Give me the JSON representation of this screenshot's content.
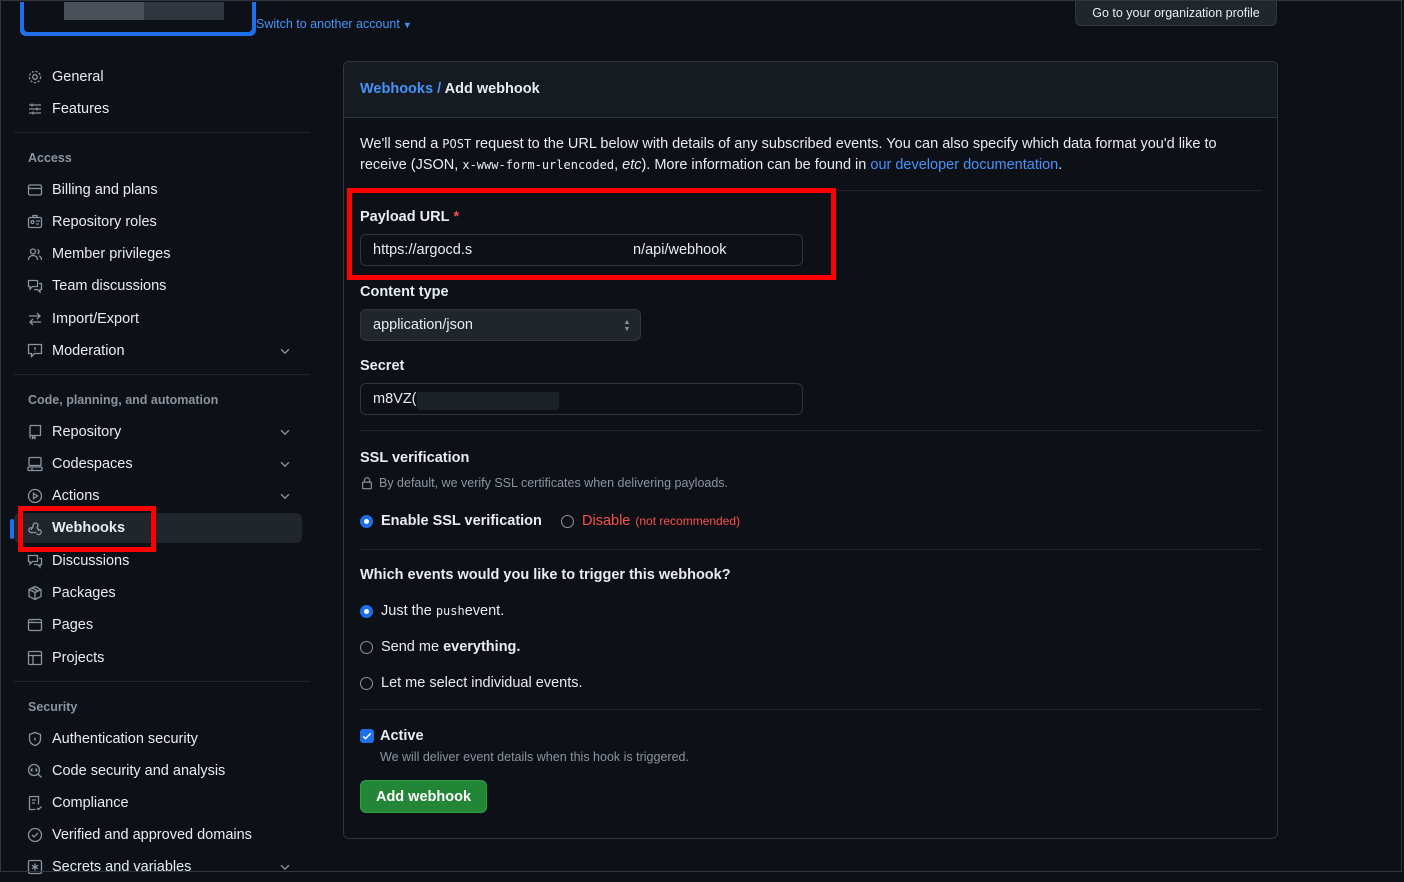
{
  "top": {
    "switch_account": "Switch to another account",
    "org_profile_button": "Go to your organization profile"
  },
  "sidebar": {
    "items_top": [
      {
        "label": "General",
        "icon": "gear-icon"
      },
      {
        "label": "Features",
        "icon": "sliders-icon"
      }
    ],
    "sections": [
      {
        "title": "Access",
        "items": [
          {
            "label": "Billing and plans",
            "icon": "credit-card-icon"
          },
          {
            "label": "Repository roles",
            "icon": "id-badge-icon"
          },
          {
            "label": "Member privileges",
            "icon": "people-icon"
          },
          {
            "label": "Team discussions",
            "icon": "comment-discussion-icon"
          },
          {
            "label": "Import/Export",
            "icon": "arrow-switch-icon"
          },
          {
            "label": "Moderation",
            "icon": "report-icon",
            "expandable": true
          }
        ]
      },
      {
        "title": "Code, planning, and automation",
        "items": [
          {
            "label": "Repository",
            "icon": "repo-icon",
            "expandable": true
          },
          {
            "label": "Codespaces",
            "icon": "codespaces-icon",
            "expandable": true
          },
          {
            "label": "Actions",
            "icon": "play-icon",
            "expandable": true
          },
          {
            "label": "Webhooks",
            "icon": "webhook-icon",
            "active": true
          },
          {
            "label": "Discussions",
            "icon": "comment-discussion-icon"
          },
          {
            "label": "Packages",
            "icon": "package-icon"
          },
          {
            "label": "Pages",
            "icon": "browser-icon"
          },
          {
            "label": "Projects",
            "icon": "table-icon"
          }
        ]
      },
      {
        "title": "Security",
        "items": [
          {
            "label": "Authentication security",
            "icon": "shield-lock-icon"
          },
          {
            "label": "Code security and analysis",
            "icon": "codescan-icon"
          },
          {
            "label": "Compliance",
            "icon": "checklist-icon"
          },
          {
            "label": "Verified and approved domains",
            "icon": "verified-icon"
          },
          {
            "label": "Secrets and variables",
            "icon": "key-asterisk-icon",
            "expandable": true
          }
        ]
      }
    ]
  },
  "main": {
    "breadcrumb_parent": "Webhooks",
    "breadcrumb_sep": "/",
    "breadcrumb_current": "Add webhook",
    "intro": {
      "t1": "We'll send a ",
      "code1": "POST",
      "t2": " request to the URL below with details of any subscribed events. You can also specify which data format you'd like to receive (JSON, ",
      "code2": "x-www-form-urlencoded",
      "t3": ", ",
      "etc": "etc",
      "t4": "). More information can be found in ",
      "link": "our developer documentation",
      "t5": "."
    },
    "payload_url": {
      "label": "Payload URL",
      "required": "*",
      "value_start": "https://argocd.s",
      "value_end": "n/api/webhook"
    },
    "content_type": {
      "label": "Content type",
      "value": "application/json"
    },
    "secret": {
      "label": "Secret",
      "value_visible": "m8VZ("
    },
    "ssl": {
      "title": "SSL verification",
      "desc": "By default, we verify SSL certificates when delivering payloads.",
      "enable": "Enable SSL verification",
      "disable": "Disable",
      "disable_note": "(not recommended)"
    },
    "events": {
      "title": "Which events would you like to trigger this webhook?",
      "opt1_pre": "Just the ",
      "opt1_code": "push",
      "opt1_post": " event.",
      "opt2_pre": "Send me ",
      "opt2_bold": "everything.",
      "opt3": "Let me select individual events."
    },
    "active": {
      "label": "Active",
      "desc": "We will deliver event details when this hook is triggered."
    },
    "submit_label": "Add webhook"
  },
  "colors": {
    "accent": "#1f6feb",
    "success": "#238636",
    "danger": "#f85149",
    "annotation": "#ff0000",
    "background": "#0d1117"
  }
}
